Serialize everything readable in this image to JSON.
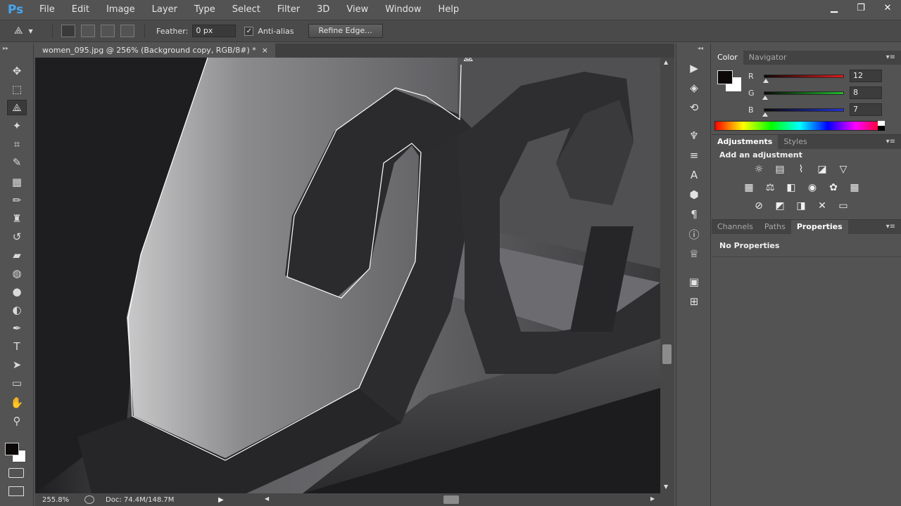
{
  "app": {
    "logo": "Ps"
  },
  "menu": [
    "File",
    "Edit",
    "Image",
    "Layer",
    "Type",
    "Select",
    "Filter",
    "3D",
    "View",
    "Window",
    "Help"
  ],
  "window_controls": {
    "minimize": "▁",
    "restore": "❐",
    "close": "✕"
  },
  "options": {
    "feather_label": "Feather:",
    "feather_value": "0 px",
    "antialias_label": "Anti-alias",
    "antialias_checked": true,
    "refine_edge_label": "Refine Edge..."
  },
  "document": {
    "tab_title": "women_095.jpg @ 256% (Background copy, RGB/8#) *",
    "close_glyph": "×"
  },
  "status": {
    "zoom": "255.8%",
    "doc_info": "Doc: 74.4M/148.7M"
  },
  "tools": [
    {
      "name": "move-tool",
      "glyph": "✥"
    },
    {
      "name": "marquee-tool",
      "glyph": "⬚"
    },
    {
      "name": "polygonal-lasso-tool",
      "glyph": "⟁",
      "active": true
    },
    {
      "name": "magic-wand-tool",
      "glyph": "✦"
    },
    {
      "name": "crop-tool",
      "glyph": "⌗"
    },
    {
      "name": "eyedropper-tool",
      "glyph": "✎"
    },
    {
      "name": "healing-brush-tool",
      "glyph": "▦"
    },
    {
      "name": "brush-tool",
      "glyph": "✏"
    },
    {
      "name": "clone-stamp-tool",
      "glyph": "♜"
    },
    {
      "name": "history-brush-tool",
      "glyph": "↺"
    },
    {
      "name": "eraser-tool",
      "glyph": "▰"
    },
    {
      "name": "paint-bucket-tool",
      "glyph": "◍"
    },
    {
      "name": "blur-tool",
      "glyph": "●"
    },
    {
      "name": "dodge-tool",
      "glyph": "◐"
    },
    {
      "name": "pen-tool",
      "glyph": "✒"
    },
    {
      "name": "type-tool",
      "glyph": "T"
    },
    {
      "name": "path-selection-tool",
      "glyph": "➤"
    },
    {
      "name": "shape-tool",
      "glyph": "▭"
    },
    {
      "name": "hand-tool",
      "glyph": "✋"
    },
    {
      "name": "zoom-tool",
      "glyph": "⚲"
    }
  ],
  "color_panel": {
    "tabs": [
      "Color",
      "Navigator"
    ],
    "active_tab": "Color",
    "r_label": "R",
    "r_value": "12",
    "g_label": "G",
    "g_value": "8",
    "b_label": "B",
    "b_value": "7",
    "foreground": "#0c0807",
    "background": "#ffffff"
  },
  "adjustments_panel": {
    "tabs": [
      "Adjustments",
      "Styles"
    ],
    "active_tab": "Adjustments",
    "heading": "Add an adjustment",
    "icons": [
      "brightness-contrast-icon",
      "levels-icon",
      "curves-icon",
      "exposure-icon",
      "vibrance-icon",
      "hue-saturation-icon",
      "color-balance-icon",
      "black-white-icon",
      "photo-filter-icon",
      "channel-mixer-icon",
      "color-lookup-icon",
      "invert-icon",
      "posterize-icon",
      "threshold-icon",
      "selective-color-icon",
      "gradient-map-icon"
    ]
  },
  "properties_panel": {
    "tabs": [
      "Channels",
      "Paths",
      "Properties"
    ],
    "active_tab": "Properties",
    "message": "No Properties"
  },
  "colors": {
    "accent_logo": "#46a6f0",
    "selection_outline": "#ffffff",
    "r_slider": "#e01b1b",
    "g_slider": "#1ebd2a",
    "b_slider": "#2034d8"
  }
}
